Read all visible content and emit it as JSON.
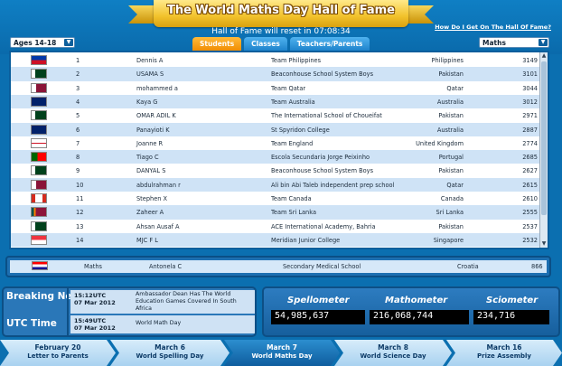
{
  "header": {
    "title": "The World Maths Day Hall of Fame",
    "reset_text": "Hall of Fame will reset in 07:08:34",
    "howto_link": "How Do I Get On The Hall Of Fame?",
    "age_filter": "Ages 14-18",
    "subject_filter": "Maths",
    "tabs": [
      "Students",
      "Classes",
      "Teachers/Parents"
    ]
  },
  "rows": [
    {
      "rank": "1",
      "flag": "philippines",
      "name": "Dennis A",
      "team": "Team Philippines",
      "country": "Philippines",
      "score": "3149"
    },
    {
      "rank": "2",
      "flag": "pakistan",
      "name": "USAMA S",
      "team": "Beaconhouse School System Boys",
      "country": "Pakistan",
      "score": "3101"
    },
    {
      "rank": "3",
      "flag": "qatar",
      "name": "mohammed a",
      "team": "Team Qatar",
      "country": "Qatar",
      "score": "3044"
    },
    {
      "rank": "4",
      "flag": "australia",
      "name": "Kaya G",
      "team": "Team Australia",
      "country": "Australia",
      "score": "3012"
    },
    {
      "rank": "5",
      "flag": "pakistan",
      "name": "OMAR ADIL K",
      "team": "The International School of Choueifat",
      "country": "Pakistan",
      "score": "2971"
    },
    {
      "rank": "6",
      "flag": "australia",
      "name": "Panayioti K",
      "team": "St Spyridon College",
      "country": "Australia",
      "score": "2887"
    },
    {
      "rank": "7",
      "flag": "england",
      "name": "Joanne R",
      "team": "Team England",
      "country": "United Kingdom",
      "score": "2774"
    },
    {
      "rank": "8",
      "flag": "portugal",
      "name": "Tiago C",
      "team": "Escola Secundaria Jorge Peixinho",
      "country": "Portugal",
      "score": "2685"
    },
    {
      "rank": "9",
      "flag": "pakistan",
      "name": "DANYAL S",
      "team": "Beaconhouse School System Boys",
      "country": "Pakistan",
      "score": "2627"
    },
    {
      "rank": "10",
      "flag": "qatar",
      "name": "abdulrahman r",
      "team": "Ali bin Abi Taleb independent prep school",
      "country": "Qatar",
      "score": "2615"
    },
    {
      "rank": "11",
      "flag": "canada",
      "name": "Stephen X",
      "team": "Team Canada",
      "country": "Canada",
      "score": "2610"
    },
    {
      "rank": "12",
      "flag": "srilanka",
      "name": "Zaheer A",
      "team": "Team Sri Lanka",
      "country": "Sri Lanka",
      "score": "2555"
    },
    {
      "rank": "13",
      "flag": "pakistan",
      "name": "Ahsan Ausaf A",
      "team": "ACE International Academy,  Bahria",
      "country": "Pakistan",
      "score": "2537"
    },
    {
      "rank": "14",
      "flag": "singapore",
      "name": "MJC F L",
      "team": "Meridian Junior College",
      "country": "Singapore",
      "score": "2532"
    }
  ],
  "own_row": {
    "flag": "croatia",
    "subject": "Maths",
    "name": "Antonela C",
    "team": "Secondary Medical School",
    "country": "Croatia",
    "score": "866"
  },
  "news": {
    "label_breaking": "Breaking News",
    "label_utc": "UTC Time",
    "items": [
      {
        "time": "15:12UTC",
        "date": "07 Mar 2012",
        "text": "Ambassador Dean Has The World Education Games Covered In South Africa"
      },
      {
        "time": "15:49UTC",
        "date": "07 Mar 2012",
        "text": "World Math Day"
      }
    ]
  },
  "counters": [
    {
      "label": "Spellometer",
      "value": "54,985,637"
    },
    {
      "label": "Mathometer",
      "value": "216,068,744"
    },
    {
      "label": "Sciometer",
      "value": "234,716"
    }
  ],
  "timeline": [
    {
      "date": "February 20",
      "event": "Letter to Parents"
    },
    {
      "date": "March 6",
      "event": "World Spelling Day"
    },
    {
      "date": "March 7",
      "event": "World Maths Day"
    },
    {
      "date": "March 8",
      "event": "World Science Day"
    },
    {
      "date": "March 16",
      "event": "Prize Assembly"
    }
  ],
  "colors": {
    "accent_orange": "#f08a00",
    "banner_gold": "#f2c22c",
    "panel_blue": "#0a5e9c",
    "row_alt": "#cfe3f6"
  }
}
